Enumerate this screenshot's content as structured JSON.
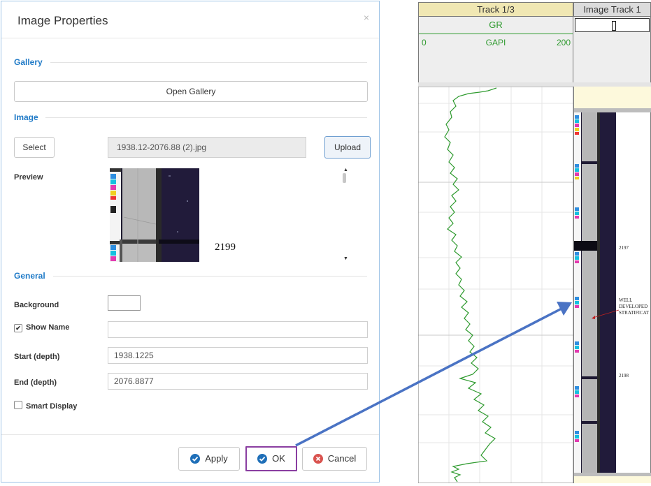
{
  "dialog": {
    "title": "Image Properties",
    "close_label": "×",
    "gallery": {
      "section_label": "Gallery",
      "open_button": "Open Gallery"
    },
    "image": {
      "section_label": "Image",
      "select_button": "Select",
      "file_name": "1938.12-2076.88 (2).jpg",
      "upload_button": "Upload",
      "preview_label": "Preview",
      "preview_depth": "2199"
    },
    "general": {
      "section_label": "General",
      "background_label": "Background",
      "show_name_label": "Show Name",
      "show_name_checked": true,
      "show_name_value": "",
      "start_label": "Start (depth)",
      "start_value": "1938.1225",
      "end_label": "End (depth)",
      "end_value": "2076.8877",
      "smart_display_label": "Smart Display",
      "smart_display_checked": false
    },
    "footer": {
      "apply_button": "Apply",
      "ok_button": "OK",
      "cancel_button": "Cancel"
    }
  },
  "log": {
    "track1": {
      "title": "Track 1/3",
      "curve_name": "GR",
      "scale_min": "0",
      "unit": "GAPI",
      "scale_max": "200",
      "curve_color": "#2e9a2e"
    },
    "image_track": {
      "title": "Image Track 1"
    },
    "core_labels": {
      "depth_1": "2197",
      "note_line1": "WELL",
      "note_line2": "DEVELOPED",
      "note_line3": "STRATIFICAT",
      "depth_2": "2198"
    }
  },
  "colors": {
    "accent": "#1f7ac7",
    "ok_highlight": "#8a3ea1",
    "arrow": "#4a73c4",
    "cancel_red": "#d9534f"
  }
}
